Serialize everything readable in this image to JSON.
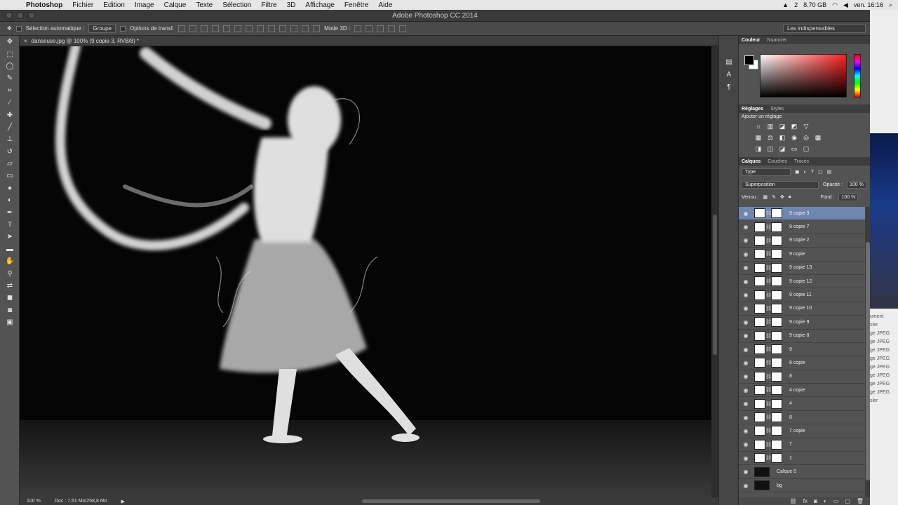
{
  "menubar": {
    "apple": "",
    "app_name": "Photoshop",
    "menus": [
      "Fichier",
      "Edition",
      "Image",
      "Calque",
      "Texte",
      "Sélection",
      "Filtre",
      "3D",
      "Affichage",
      "Fenêtre",
      "Aide"
    ],
    "status": {
      "badge": "2",
      "disk": "8.70 GB",
      "clock": "ven. 16:16"
    }
  },
  "window": {
    "title": "Adobe Photoshop CC 2014"
  },
  "options_bar": {
    "auto_select_label": "Sélection automatique :",
    "auto_select_value": "Groupe",
    "transform_label": "Options de transf.",
    "mode3d_label": "Mode 3D :",
    "workspace": "Les indispensables"
  },
  "document": {
    "tab_title": "danseuse.jpg @ 100% (9 copie 3, RVB/8) *",
    "zoom": "100 %",
    "doc_info": "Doc : 7,51 Mo/258,8 Mo"
  },
  "panels": {
    "color_tabs": [
      "Couleur",
      "Nuancier"
    ],
    "adjust_tabs": [
      "Réglages",
      "Styles"
    ],
    "adjust_title": "Ajouter un réglage",
    "layers_tabs": [
      "Calques",
      "Couches",
      "Tracés"
    ],
    "filter_kind": "Type",
    "blend_mode": "Superposition",
    "opacity_label": "Opacité :",
    "opacity_value": "100 %",
    "lock_label": "Verrou :",
    "fill_label": "Fond :",
    "fill_value": "100 %"
  },
  "layers": [
    "9 copie 3",
    "9 copie 7",
    "9 copie 2",
    "9 copie",
    "9 copie 13",
    "9 copie 12",
    "9 copie 11",
    "9 copie 10",
    "9 copie 9",
    "9 copie 8",
    "9",
    "8 copie",
    "8",
    "4 copie",
    "4",
    "8",
    "7 copie",
    "7",
    "1",
    "Calque 0",
    "bg"
  ],
  "finder_side": {
    "items": [
      "ument",
      "sler",
      "ge JPEG",
      "ge JPEG",
      "ge JPEG",
      "ge JPEG",
      "ge JPEG",
      "ge JPEG",
      "ge JPEG",
      "ge JPEG",
      "sler"
    ]
  }
}
